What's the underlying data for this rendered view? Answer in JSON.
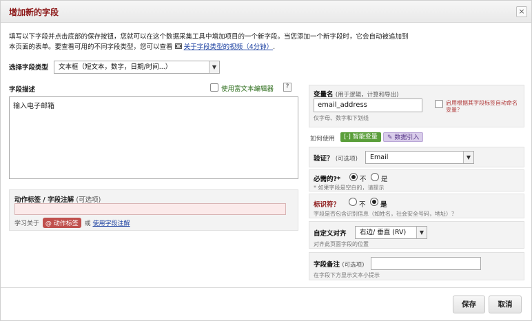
{
  "dialog": {
    "title": "增加新的字段",
    "close_label": "×"
  },
  "intro": {
    "line1": "填写以下字段并点击底部的保存按钮，您就可以在这个数据采集工具中增加项目的一个新字段。当您添加一个新字段时，它会自动被追加到",
    "line2_prefix": "本页面的表单。要查看可用的不同字段类型，您可以查看",
    "video_link": "关于字段类型的视频（4分钟）",
    "line2_suffix": "."
  },
  "field_type": {
    "label": "选择字段类型",
    "value": "文本框（短文本，数字，日期/时间...）"
  },
  "description": {
    "label": "字段描述",
    "rich_text_label": "使用富文本编辑器",
    "help": "?",
    "value": "输入电子邮箱"
  },
  "action_tags": {
    "label": "动作标签 / 字段注解",
    "optional": "(可选项)",
    "learn_prefix": "学习关于",
    "badge": "@ 动作标签",
    "or": "或",
    "link": "使用字段注解"
  },
  "variable": {
    "label": "变量名",
    "sub": "(用于逻辑，计算和导出)",
    "value": "email_address",
    "hint": "仅字母、数字和下划线",
    "autoname": "启用根据其字段标签自动命名变量？"
  },
  "howto": {
    "label": "如何使用",
    "smart_button": "[·] 智能变量",
    "piping_button": "✎ 数据引入"
  },
  "validation": {
    "label": "验证？",
    "optional": "(可选项)",
    "value": "Email"
  },
  "required": {
    "label": "必需的?*",
    "no": "不",
    "yes": "是",
    "selected": "no",
    "hint": "* 如果字段是空白的，请提示"
  },
  "identifier": {
    "label": "标识符？",
    "no": "不",
    "yes": "是",
    "selected": "yes",
    "hint": "字段是否包含识别信息（如姓名，社会安全号码，地址）？"
  },
  "alignment": {
    "label": "自定义对齐",
    "value": "右边/ 垂直 (RV)",
    "hint": "对齐此页面字段的位置"
  },
  "field_note": {
    "label": "字段备注",
    "optional": "(可选项)",
    "hint": "在字段下方显示文本小提示"
  },
  "footer": {
    "save": "保存",
    "cancel": "取消"
  },
  "colors": {
    "title": "#8b1515",
    "link": "#1a3fa0",
    "smart_button": "#5a9e3a",
    "badge": "#c0504d"
  }
}
